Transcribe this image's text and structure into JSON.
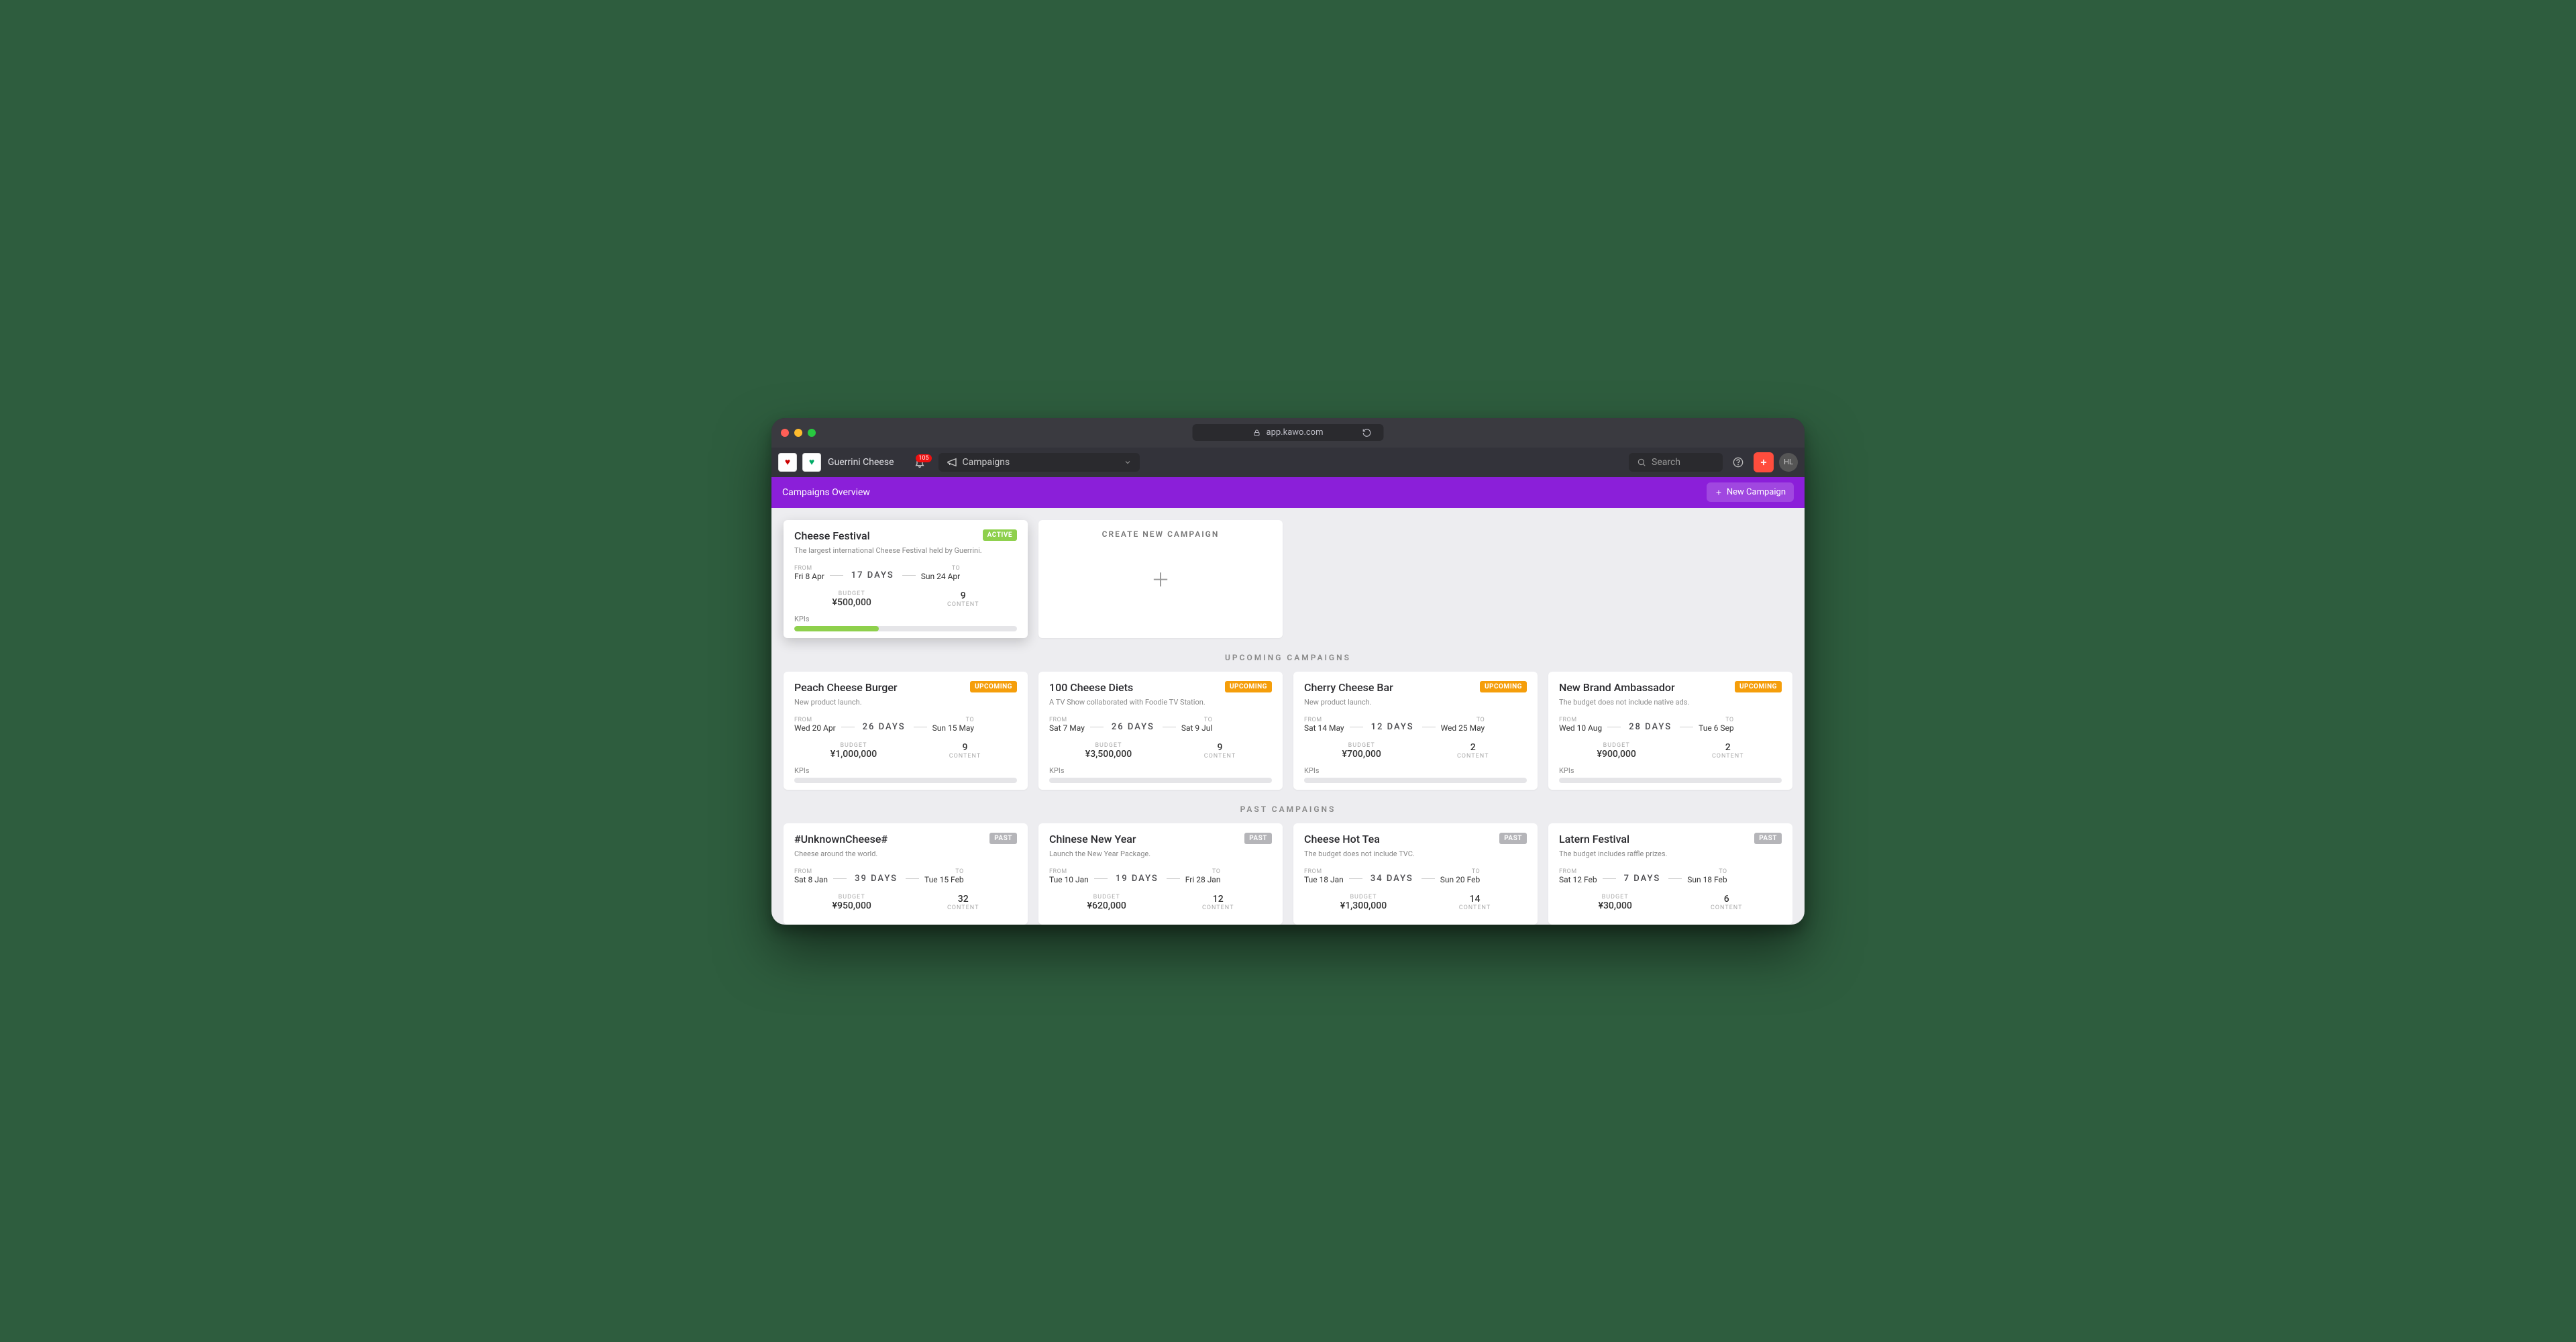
{
  "browser": {
    "url": "app.kawo.com"
  },
  "appbar": {
    "brand": "Guerrini Cheese",
    "nav_label": "Campaigns",
    "search_placeholder": "Search",
    "notif_count": "105",
    "avatar_initials": "HL"
  },
  "subheader": {
    "title": "Campaigns Overview",
    "new_btn": "New Campaign"
  },
  "create_card_label": "CREATE NEW CAMPAIGN",
  "sections": {
    "upcoming_title": "UPCOMING CAMPAIGNS",
    "past_title": "PAST CAMPAIGNS"
  },
  "labels": {
    "from": "FROM",
    "to": "TO",
    "budget": "BUDGET",
    "content": "CONTENT",
    "kpis": "KPIs"
  },
  "active": {
    "title": "Cheese Festival",
    "badge": "ACTIVE",
    "desc": "The largest international Cheese Festival held by Guerrini.",
    "from": "Fri 8 Apr",
    "to": "Sun 24 Apr",
    "duration": "17 DAYS",
    "budget": "¥500,000",
    "content": "9",
    "kpi_pct": 38
  },
  "upcoming": [
    {
      "title": "Peach Cheese Burger",
      "badge": "UPCOMING",
      "desc": "New product launch.",
      "from": "Wed 20 Apr",
      "to": "Sun 15 May",
      "duration": "26 DAYS",
      "budget": "¥1,000,000",
      "content": "9",
      "kpi_pct": 0
    },
    {
      "title": "100 Cheese Diets",
      "badge": "UPCOMING",
      "desc": "A TV Show collaborated with Foodie TV Station.",
      "from": "Sat 7 May",
      "to": "Sat 9 Jul",
      "duration": "26 DAYS",
      "budget": "¥3,500,000",
      "content": "9",
      "kpi_pct": 0
    },
    {
      "title": "Cherry Cheese Bar",
      "badge": "UPCOMING",
      "desc": "New product launch.",
      "from": "Sat 14 May",
      "to": "Wed 25 May",
      "duration": "12 DAYS",
      "budget": "¥700,000",
      "content": "2",
      "kpi_pct": 0
    },
    {
      "title": "New Brand Ambassador",
      "badge": "UPCOMING",
      "desc": "The budget does not include native ads.",
      "from": "Wed 10 Aug",
      "to": "Tue 6 Sep",
      "duration": "28 DAYS",
      "budget": "¥900,000",
      "content": "2",
      "kpi_pct": 0
    }
  ],
  "past": [
    {
      "title": "#UnknownCheese#",
      "badge": "PAST",
      "desc": "Cheese around the world.",
      "from": "Sat 8 Jan",
      "to": "Tue 15 Feb",
      "duration": "39 DAYS",
      "budget": "¥950,000",
      "content": "32"
    },
    {
      "title": "Chinese New Year",
      "badge": "PAST",
      "desc": "Launch the New Year Package.",
      "from": "Tue 10 Jan",
      "to": "Fri 28 Jan",
      "duration": "19 DAYS",
      "budget": "¥620,000",
      "content": "12"
    },
    {
      "title": "Cheese Hot Tea",
      "badge": "PAST",
      "desc": "The budget does not include TVC.",
      "from": "Tue 18 Jan",
      "to": "Sun 20 Feb",
      "duration": "34 DAYS",
      "budget": "¥1,300,000",
      "content": "14"
    },
    {
      "title": "Latern Festival",
      "badge": "PAST",
      "desc": "The budget includes raffle prizes.",
      "from": "Sat 12 Feb",
      "to": "Sun 18 Feb",
      "duration": "7 DAYS",
      "budget": "¥30,000",
      "content": "6"
    }
  ]
}
